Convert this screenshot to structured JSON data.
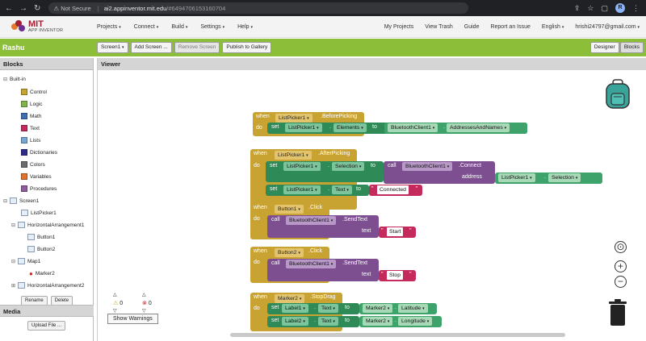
{
  "browser": {
    "security": "Not Secure",
    "url_host": "ai2.appinventor.mit.edu",
    "url_path": "/#6494706153160704",
    "avatar_letter": "R"
  },
  "app_header": {
    "logo_line1": "MIT",
    "logo_line2": "APP INVENTOR",
    "menus": [
      "Projects",
      "Connect",
      "Build",
      "Settings",
      "Help"
    ],
    "links": [
      "My Projects",
      "View Trash",
      "Guide",
      "Report an Issue",
      "English",
      "hrishi24797@gmail.com"
    ]
  },
  "toolbar": {
    "project_name": "Rashu",
    "screen_select": "Screen1",
    "add_screen": "Add Screen ...",
    "remove_screen": "Remove Screen",
    "publish": "Publish to Gallery",
    "designer": "Designer",
    "blocks": "Blocks"
  },
  "left_panel": {
    "title": "Blocks",
    "builtin_label": "Built-in",
    "builtin": [
      {
        "label": "Control",
        "color": "#c8a331"
      },
      {
        "label": "Logic",
        "color": "#7fb547"
      },
      {
        "label": "Math",
        "color": "#3f6cb5"
      },
      {
        "label": "Text",
        "color": "#c42a5c"
      },
      {
        "label": "Lists",
        "color": "#73a7d6"
      },
      {
        "label": "Dictionaries",
        "color": "#2d2a8c"
      },
      {
        "label": "Colors",
        "color": "#6b6b6b"
      },
      {
        "label": "Variables",
        "color": "#e0722c"
      },
      {
        "label": "Procedures",
        "color": "#8e5aa0"
      }
    ],
    "components": {
      "screen": "Screen1",
      "listpicker": "ListPicker1",
      "ha1": "HorizontalArrangement1",
      "button1": "Button1",
      "button2": "Button2",
      "map": "Map1",
      "marker": "Marker2",
      "ha2": "HorizontalArrangement2"
    },
    "rename": "Rename",
    "delete": "Delete",
    "media_title": "Media",
    "upload": "Upload File ..."
  },
  "viewer": {
    "title": "Viewer",
    "warnings_count": "0",
    "errors_count": "0",
    "show_warnings": "Show Warnings"
  },
  "blocks": {
    "b1": {
      "when": "when",
      "comp": "ListPicker1",
      "event": ".BeforePicking",
      "do": "do",
      "set": "set",
      "target": "ListPicker1",
      "prop": "Elements",
      "to": "to",
      "src": "BluetoothClient1",
      "src_prop": "AddressesAndNames"
    },
    "b2": {
      "when": "when",
      "comp": "ListPicker1",
      "event": ".AfterPicking",
      "do": "do",
      "set": "set",
      "target": "ListPicker1",
      "prop": "Selection",
      "to": "to",
      "call": "call",
      "client": "BluetoothClient1",
      "method": ".Connect",
      "address": "address",
      "addr_comp": "ListPicker1",
      "addr_prop": "Selection",
      "set2": "set",
      "target2": "ListPicker1",
      "prop2": "Text",
      "to2": "to",
      "text_value": "Connected"
    },
    "b3": {
      "when": "when",
      "comp": "Button1",
      "event": ".Click",
      "do": "do",
      "call": "call",
      "client": "BluetoothClient1",
      "method": ".SendText",
      "text": "text",
      "value": "Start"
    },
    "b4": {
      "when": "when",
      "comp": "Button2",
      "event": ".Click",
      "do": "do",
      "call": "call",
      "client": "BluetoothClient1",
      "method": ".SendText",
      "text": "text",
      "value": "Stop"
    },
    "b5": {
      "when": "when",
      "comp": "Marker2",
      "event": ".StopDrag",
      "do": "do",
      "set": "set",
      "target": "Label1",
      "prop": "Text",
      "to": "to",
      "src": "Marker2",
      "src_prop": "Latitude",
      "set2": "set",
      "target2": "Label2",
      "prop2": "Text",
      "to2": "to",
      "src2": "Marker2",
      "src_prop2": "Longitude"
    }
  },
  "glyphs": {
    "caret": "▾",
    "quote": "\""
  }
}
